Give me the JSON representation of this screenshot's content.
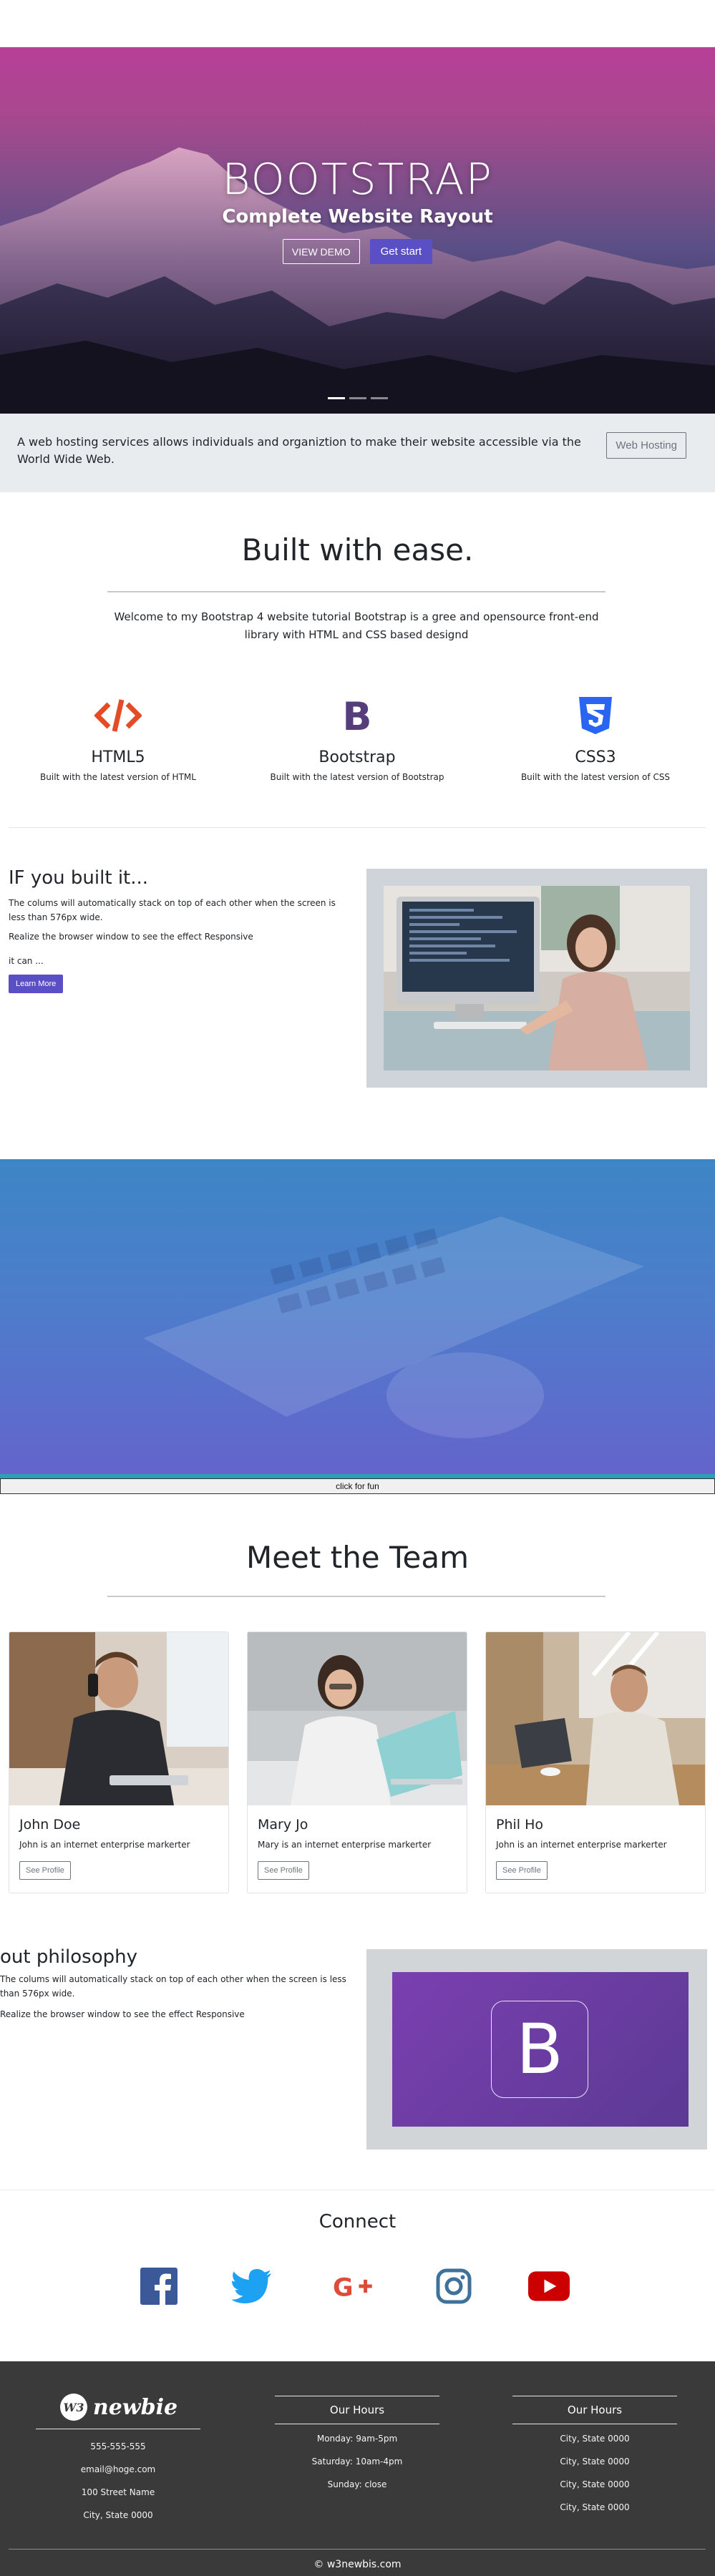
{
  "hero": {
    "title": "BOOTSTRAP",
    "subtitle": "Complete Website Rayout",
    "view_demo_label": "VIEW DEMO",
    "get_started_label": "Get start"
  },
  "jumbotron": {
    "text": "A web hosting services allows individuals and organiztion to make their website accessible via the World Wide Web.",
    "button_label": "Web Hosting"
  },
  "welcome": {
    "title": "Built with ease.",
    "text": "Welcome to my Bootstrap 4 website tutorial Bootstrap is a gree and opensource front-end library with HTML and CSS based designd"
  },
  "features": [
    {
      "icon": "html5-code-icon",
      "title": "HTML5",
      "desc": "Built with the latest version of HTML",
      "color": "#e34c26"
    },
    {
      "icon": "bootstrap-icon",
      "title": "Bootstrap",
      "desc": "Built with the latest version of Bootstrap",
      "color": "#563d7c"
    },
    {
      "icon": "css3-icon",
      "title": "CSS3",
      "desc": "Built with the latest version of CSS",
      "color": "#2965f1"
    }
  ],
  "built": {
    "title": "IF you built it...",
    "p1": "The colums will automatically stack on top of each other when the screen is less than 576px wide.",
    "p2": "Realize the browser window to see the effect Responsive",
    "p3": "it can ...",
    "button_label": "Learn More"
  },
  "fun_button_label": "click for fun",
  "team": {
    "title": "Meet the Team",
    "members": [
      {
        "name": "John Doe",
        "text": "John is an internet enterprise markerter",
        "button_label": "See Profile"
      },
      {
        "name": "Mary Jo",
        "text": "Mary is an internet enterprise markerter",
        "button_label": "See Profile"
      },
      {
        "name": "Phil Ho",
        "text": "John is an internet enterprise markerter",
        "button_label": "See Profile"
      }
    ]
  },
  "philosophy": {
    "title": "out philosophy",
    "p1": "The colums will automatically stack on top of each other when the screen is less than 576px wide.",
    "p2": "Realize the browser window to see the effect Responsive",
    "logo_letter": "B"
  },
  "connect": {
    "title": "Connect",
    "icons": [
      "facebook-icon",
      "twitter-icon",
      "google-plus-icon",
      "instagram-icon",
      "youtube-icon"
    ],
    "colors": {
      "facebook": "#3b5998",
      "twitter": "#1da1f2",
      "google": "#dd4b39",
      "instagram": "#3f729b",
      "youtube": "#cc0000"
    }
  },
  "footer": {
    "logo_mark": "W3",
    "logo_text": "newbie",
    "contact": [
      "555-555-555",
      "email@hoge.com",
      "100 Street Name",
      "City, State 0000"
    ],
    "hours_heading": "Our Hours",
    "hours": [
      "Monday: 9am-5pm",
      "Saturday: 10am-4pm",
      "Sunday: close"
    ],
    "hours2_heading": "Our Hours",
    "hours2": [
      "City, State 0000",
      "City, State 0000",
      "City, State 0000",
      "City, State 0000"
    ],
    "copyright": "© w3newbis.com"
  },
  "colors": {
    "accent": "#5a4fc4",
    "footer_bg": "#3a3a3a",
    "jumbotron_bg": "#e9ecef"
  }
}
